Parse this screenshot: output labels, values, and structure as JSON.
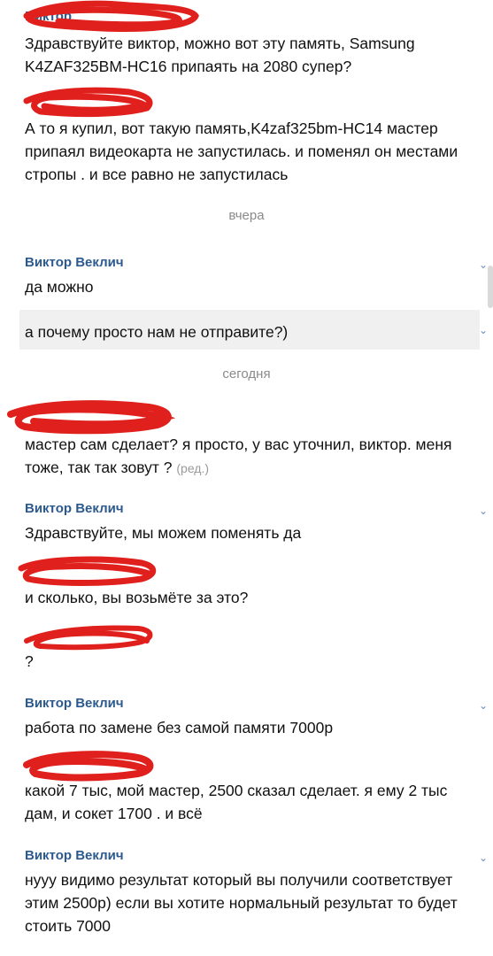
{
  "messages": [
    {
      "sender": "Виктор",
      "redacted": true,
      "text": "Здравствуйте виктор, можно вот эту память, Samsung K4ZAF325BM-HC16 припаять на 2080 супер?"
    },
    {
      "sender": "",
      "redacted": true,
      "text": "А то я купил, вот такую память,K4zaf325bm-HC14  мастер припаял видеокарта не запустилась. и поменял он местами стропы . и все равно не запустилась"
    },
    {
      "sender": "Виктор Веклич",
      "redacted": false,
      "text": "да можно"
    },
    {
      "sender": "",
      "redacted": false,
      "text": "а почему просто нам не отправите?)"
    },
    {
      "sender": "",
      "redacted": true,
      "text": "мастер сам сделает? я просто, у вас уточнил, виктор. меня тоже, так так зовут ?",
      "edited": "(ред.)"
    },
    {
      "sender": "Виктор Веклич",
      "redacted": false,
      "text": "Здравствуйте, мы можем поменять да"
    },
    {
      "sender": "",
      "redacted": true,
      "text": "и сколько, вы возьмёте за это?"
    },
    {
      "sender": "",
      "redacted": true,
      "text": "?"
    },
    {
      "sender": "Виктор Веклич",
      "redacted": false,
      "text": "работа по замене  без самой памяти 7000р"
    },
    {
      "sender": "",
      "redacted": true,
      "text": "какой 7 тыс, мой мастер, 2500 сказал сделает. я ему 2 тыс дам, и сокет 1700 . и всё"
    },
    {
      "sender": "Виктор Веклич",
      "redacted": false,
      "text": "нууу видимо результат который вы получили соответствует этим 2500р) если вы хотите нормальный результат то будет стоить 7000"
    }
  ],
  "separators": {
    "yesterday": "вчера",
    "today": "сегодня"
  },
  "icons": {
    "message_menu": "chevron-down-icon",
    "redaction": "red-scribble"
  },
  "colors": {
    "sender_name": "#2c5a8e",
    "redaction": "#e0201c",
    "separator": "#8a8a8a",
    "highlight": "#f0f0f0"
  }
}
